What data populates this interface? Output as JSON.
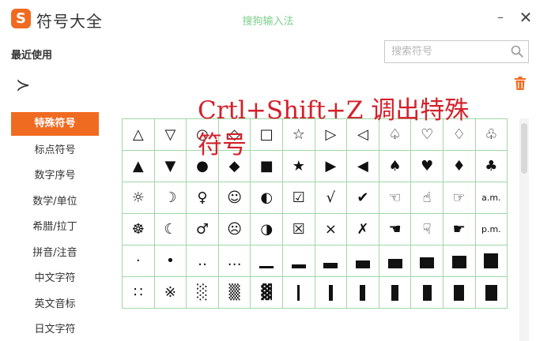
{
  "window": {
    "logo_letter": "S",
    "title": "符号大全",
    "brand": "搜狗输入法",
    "minimize": "–",
    "close": "✕"
  },
  "recent": {
    "label": "最近使用",
    "symbols": [
      "≻"
    ]
  },
  "search": {
    "placeholder": "搜索符号",
    "value": ""
  },
  "sidebar": {
    "items": [
      {
        "label": "特殊符号",
        "active": true
      },
      {
        "label": "标点符号",
        "active": false
      },
      {
        "label": "数字序号",
        "active": false
      },
      {
        "label": "数学/单位",
        "active": false
      },
      {
        "label": "希腊/拉丁",
        "active": false
      },
      {
        "label": "拼音/注音",
        "active": false
      },
      {
        "label": "中文字符",
        "active": false
      },
      {
        "label": "英文音标",
        "active": false
      },
      {
        "label": "日文字符",
        "active": false
      }
    ]
  },
  "symbols": {
    "rows": [
      [
        "△",
        "▽",
        "○",
        "◇",
        "□",
        "☆",
        "▷",
        "◁",
        "♤",
        "♡",
        "♢",
        "♧"
      ],
      [
        "▲",
        "▼",
        "●",
        "◆",
        "■",
        "★",
        "▶",
        "◀",
        "♠",
        "♥",
        "♦",
        "♣"
      ],
      [
        "☼",
        "☽",
        "♀",
        "☺",
        "◐",
        "☑",
        "√",
        "✔",
        "☜",
        "☝",
        "☞",
        "a.m."
      ],
      [
        "☸",
        "☾",
        "♂",
        "☹",
        "◑",
        "☒",
        "×",
        "✗",
        "☚",
        "☟",
        "☛",
        "p.m."
      ],
      [
        "·",
        "•",
        "‥",
        "…",
        "▁",
        "▂",
        "▃",
        "▄",
        "▅",
        "▆",
        "▇",
        "█"
      ],
      [
        "∷",
        "※",
        "░",
        "▒",
        "▓",
        "▏",
        "▎",
        "▍",
        "▌",
        "▋",
        "▊",
        "▉"
      ]
    ]
  },
  "caption": {
    "line1": "Crtl+Shift+Z 调出特殊",
    "line2": "符号"
  },
  "colors": {
    "accent": "#f06b22",
    "grid_line": "#9fd8a6",
    "caption": "#d4202a",
    "brand": "#7ccf8a"
  }
}
